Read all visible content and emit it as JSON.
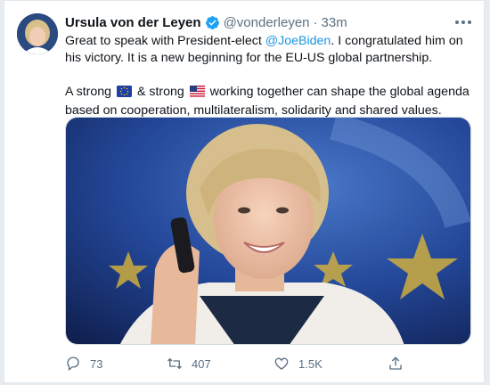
{
  "tweet": {
    "display_name": "Ursula von der Leyen",
    "handle": "@vonderleyen",
    "separator": "·",
    "time": "33m",
    "text_before_mention": "Great to speak with President-elect ",
    "mention": "@JoeBiden",
    "text_after_mention": ". I congratulated him on his victory. It is a new beginning for the EU-US global partnership.",
    "line2_part1": "A strong ",
    "line2_part2": " & strong ",
    "line2_part3": " working together can shape the global agenda based on cooperation, multilateralism, solidarity and shared values."
  },
  "actions": {
    "replies": "73",
    "retweets": "407",
    "likes": "1.5K"
  },
  "icons": {
    "verified": "verified-badge-icon",
    "more": "more-options-icon",
    "reply": "reply-icon",
    "retweet": "retweet-icon",
    "like": "heart-icon",
    "share": "share-icon",
    "eu_flag": "eu-flag-emoji",
    "us_flag": "us-flag-emoji"
  },
  "colors": {
    "link": "#1b95e0",
    "verified": "#1da1f2",
    "muted": "#5b7083"
  }
}
